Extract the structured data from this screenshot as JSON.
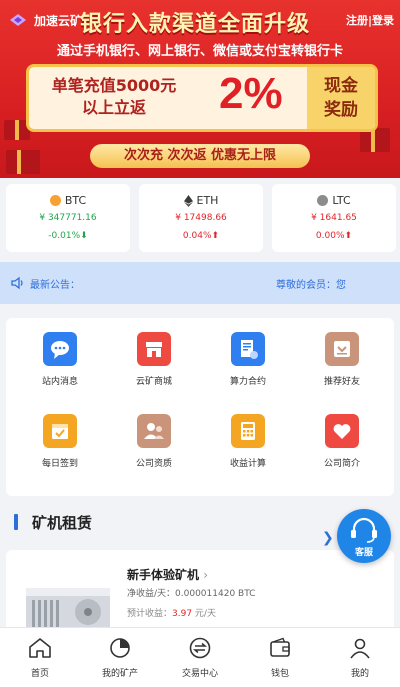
{
  "banner": {
    "app_name": "加速云矿",
    "headline": "银行入款渠道全面升级",
    "subline": "通过手机银行、网上银行、微信或支付宝转银行卡",
    "promo_left_line1": "单笔充值5000元",
    "promo_left_line2": "以上立返",
    "promo_percent": "2%",
    "promo_right_line1": "现金",
    "promo_right_line2": "奖励",
    "pill_text": "次次充 次次返 优惠无上限",
    "register": "注册",
    "login": "登录",
    "auth_divider": "|"
  },
  "coins": [
    {
      "name": "BTC",
      "price": "¥ 347771.16",
      "change": "-0.01%",
      "arrow": "⬇",
      "trend": "down",
      "icon_color": "#f7a133"
    },
    {
      "name": "ETH",
      "price": "¥ 17498.66",
      "change": "0.04%",
      "arrow": "⬆",
      "trend": "up",
      "icon_color": "#3c3c3d"
    },
    {
      "name": "LTC",
      "price": "¥ 1641.65",
      "change": "0.00%",
      "arrow": "⬆",
      "trend": "up",
      "icon_color": "#8c8c8c"
    }
  ],
  "notice": {
    "label": "最新公告：",
    "message": "尊敬的会员：您"
  },
  "grid": [
    {
      "label": "站内消息",
      "icon": "chat-bubble-icon",
      "color": "#2f7ff0"
    },
    {
      "label": "云矿商城",
      "icon": "shop-icon",
      "color": "#ef4a42"
    },
    {
      "label": "算力合约",
      "icon": "contract-icon",
      "color": "#2f7ff0"
    },
    {
      "label": "推荐好友",
      "icon": "recommend-icon",
      "color": "#c9947a"
    },
    {
      "label": "每日签到",
      "icon": "checkin-icon",
      "color": "#f4a623"
    },
    {
      "label": "公司资质",
      "icon": "certification-icon",
      "color": "#c9947a"
    },
    {
      "label": "收益计算",
      "icon": "calculator-icon",
      "color": "#f4a623"
    },
    {
      "label": "公司简介",
      "icon": "heart-icon",
      "color": "#ef4a42"
    }
  ],
  "section": {
    "title": "矿机租赁",
    "more": "❯"
  },
  "service": {
    "label": "客服"
  },
  "product": {
    "title": "新手体验矿机",
    "title_arrow": "›",
    "income_label": "净收益/天：",
    "income_value": "0.000011420 BTC",
    "expected_label": "预计收益：",
    "expected_value": "3.97",
    "expected_unit": " 元/天"
  },
  "tabs": [
    {
      "label": "首页",
      "icon": "home-icon"
    },
    {
      "label": "我的矿产",
      "icon": "pie-chart-icon"
    },
    {
      "label": "交易中心",
      "icon": "exchange-icon"
    },
    {
      "label": "钱包",
      "icon": "wallet-icon"
    },
    {
      "label": "我的",
      "icon": "user-icon"
    }
  ]
}
